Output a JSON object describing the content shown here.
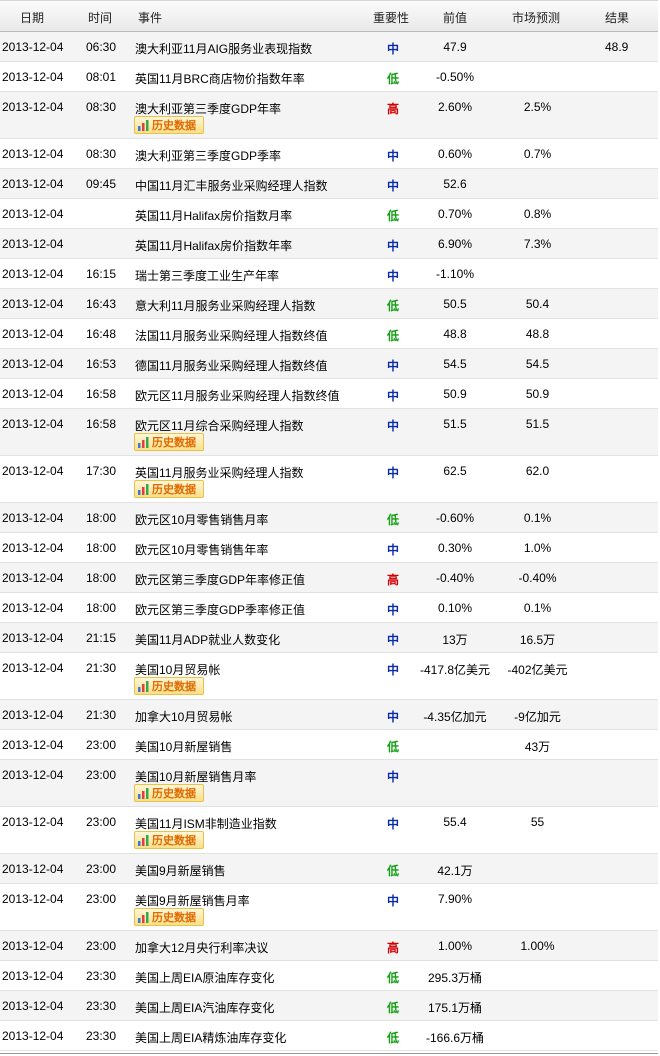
{
  "header": {
    "date": "日期",
    "time": "时间",
    "event": "事件",
    "importance": "重要性",
    "previous": "前值",
    "forecast": "市场预测",
    "result": "结果"
  },
  "history_label": "历史数据",
  "colors": {
    "high": "#d40000",
    "mid": "#0a2ca8",
    "low": "#12a012",
    "history_text": "#e06a00"
  },
  "rows": [
    {
      "date": "2013-12-04",
      "time": "06:30",
      "event": "澳大利亚11月AIG服务业表现指数",
      "importance": "中",
      "level": "mid",
      "previous": "47.9",
      "forecast": "",
      "result": "48.9",
      "history": false
    },
    {
      "date": "2013-12-04",
      "time": "08:01",
      "event": "英国11月BRC商店物价指数年率",
      "importance": "低",
      "level": "low",
      "previous": "-0.50%",
      "forecast": "",
      "result": "",
      "history": false
    },
    {
      "date": "2013-12-04",
      "time": "08:30",
      "event": "澳大利亚第三季度GDP年率",
      "importance": "高",
      "level": "high",
      "previous": "2.60%",
      "forecast": "2.5%",
      "result": "",
      "history": true
    },
    {
      "date": "2013-12-04",
      "time": "08:30",
      "event": "澳大利亚第三季度GDP季率",
      "importance": "中",
      "level": "mid",
      "previous": "0.60%",
      "forecast": "0.7%",
      "result": "",
      "history": false
    },
    {
      "date": "2013-12-04",
      "time": "09:45",
      "event": "中国11月汇丰服务业采购经理人指数",
      "importance": "中",
      "level": "mid",
      "previous": "52.6",
      "forecast": "",
      "result": "",
      "history": false
    },
    {
      "date": "2013-12-04",
      "time": "",
      "event": "英国11月Halifax房价指数月率",
      "importance": "低",
      "level": "low",
      "previous": "0.70%",
      "forecast": "0.8%",
      "result": "",
      "history": false
    },
    {
      "date": "2013-12-04",
      "time": "",
      "event": "英国11月Halifax房价指数年率",
      "importance": "中",
      "level": "mid",
      "previous": "6.90%",
      "forecast": "7.3%",
      "result": "",
      "history": false
    },
    {
      "date": "2013-12-04",
      "time": "16:15",
      "event": "瑞士第三季度工业生产年率",
      "importance": "中",
      "level": "mid",
      "previous": "-1.10%",
      "forecast": "",
      "result": "",
      "history": false
    },
    {
      "date": "2013-12-04",
      "time": "16:43",
      "event": "意大利11月服务业采购经理人指数",
      "importance": "低",
      "level": "low",
      "previous": "50.5",
      "forecast": "50.4",
      "result": "",
      "history": false
    },
    {
      "date": "2013-12-04",
      "time": "16:48",
      "event": "法国11月服务业采购经理人指数终值",
      "importance": "低",
      "level": "low",
      "previous": "48.8",
      "forecast": "48.8",
      "result": "",
      "history": false
    },
    {
      "date": "2013-12-04",
      "time": "16:53",
      "event": "德国11月服务业采购经理人指数终值",
      "importance": "中",
      "level": "mid",
      "previous": "54.5",
      "forecast": "54.5",
      "result": "",
      "history": false
    },
    {
      "date": "2013-12-04",
      "time": "16:58",
      "event": "欧元区11月服务业采购经理人指数终值",
      "importance": "中",
      "level": "mid",
      "previous": "50.9",
      "forecast": "50.9",
      "result": "",
      "history": false
    },
    {
      "date": "2013-12-04",
      "time": "16:58",
      "event": "欧元区11月综合采购经理人指数",
      "importance": "中",
      "level": "mid",
      "previous": "51.5",
      "forecast": "51.5",
      "result": "",
      "history": true
    },
    {
      "date": "2013-12-04",
      "time": "17:30",
      "event": "英国11月服务业采购经理人指数",
      "importance": "中",
      "level": "mid",
      "previous": "62.5",
      "forecast": "62.0",
      "result": "",
      "history": true
    },
    {
      "date": "2013-12-04",
      "time": "18:00",
      "event": "欧元区10月零售销售月率",
      "importance": "低",
      "level": "low",
      "previous": "-0.60%",
      "forecast": "0.1%",
      "result": "",
      "history": false
    },
    {
      "date": "2013-12-04",
      "time": "18:00",
      "event": "欧元区10月零售销售年率",
      "importance": "中",
      "level": "mid",
      "previous": "0.30%",
      "forecast": "1.0%",
      "result": "",
      "history": false
    },
    {
      "date": "2013-12-04",
      "time": "18:00",
      "event": "欧元区第三季度GDP年率修正值",
      "importance": "高",
      "level": "high",
      "previous": "-0.40%",
      "forecast": "-0.40%",
      "result": "",
      "history": false
    },
    {
      "date": "2013-12-04",
      "time": "18:00",
      "event": "欧元区第三季度GDP季率修正值",
      "importance": "中",
      "level": "mid",
      "previous": "0.10%",
      "forecast": "0.1%",
      "result": "",
      "history": false
    },
    {
      "date": "2013-12-04",
      "time": "21:15",
      "event": "美国11月ADP就业人数变化",
      "importance": "中",
      "level": "mid",
      "previous": "13万",
      "forecast": "16.5万",
      "result": "",
      "history": false
    },
    {
      "date": "2013-12-04",
      "time": "21:30",
      "event": "美国10月贸易帐",
      "importance": "中",
      "level": "mid",
      "previous": "-417.8亿美元",
      "forecast": "-402亿美元",
      "result": "",
      "history": true
    },
    {
      "date": "2013-12-04",
      "time": "21:30",
      "event": "加拿大10月贸易帐",
      "importance": "中",
      "level": "mid",
      "previous": "-4.35亿加元",
      "forecast": "-9亿加元",
      "result": "",
      "history": false
    },
    {
      "date": "2013-12-04",
      "time": "23:00",
      "event": "美国10月新屋销售",
      "importance": "低",
      "level": "low",
      "previous": "",
      "forecast": "43万",
      "result": "",
      "history": false
    },
    {
      "date": "2013-12-04",
      "time": "23:00",
      "event": "美国10月新屋销售月率",
      "importance": "中",
      "level": "mid",
      "previous": "",
      "forecast": "",
      "result": "",
      "history": true
    },
    {
      "date": "2013-12-04",
      "time": "23:00",
      "event": "美国11月ISM非制造业指数",
      "importance": "中",
      "level": "mid",
      "previous": "55.4",
      "forecast": "55",
      "result": "",
      "history": true
    },
    {
      "date": "2013-12-04",
      "time": "23:00",
      "event": "美国9月新屋销售",
      "importance": "低",
      "level": "low",
      "previous": "42.1万",
      "forecast": "",
      "result": "",
      "history": false
    },
    {
      "date": "2013-12-04",
      "time": "23:00",
      "event": "美国9月新屋销售月率",
      "importance": "中",
      "level": "mid",
      "previous": "7.90%",
      "forecast": "",
      "result": "",
      "history": true
    },
    {
      "date": "2013-12-04",
      "time": "23:00",
      "event": "加拿大12月央行利率决议",
      "importance": "高",
      "level": "high",
      "previous": "1.00%",
      "forecast": "1.00%",
      "result": "",
      "history": false
    },
    {
      "date": "2013-12-04",
      "time": "23:30",
      "event": "美国上周EIA原油库存变化",
      "importance": "低",
      "level": "low",
      "previous": "295.3万桶",
      "forecast": "",
      "result": "",
      "history": false
    },
    {
      "date": "2013-12-04",
      "time": "23:30",
      "event": "美国上周EIA汽油库存变化",
      "importance": "低",
      "level": "low",
      "previous": "175.1万桶",
      "forecast": "",
      "result": "",
      "history": false
    },
    {
      "date": "2013-12-04",
      "time": "23:30",
      "event": "美国上周EIA精炼油库存变化",
      "importance": "低",
      "level": "low",
      "previous": "-166.6万桶",
      "forecast": "",
      "result": "",
      "history": false
    }
  ]
}
